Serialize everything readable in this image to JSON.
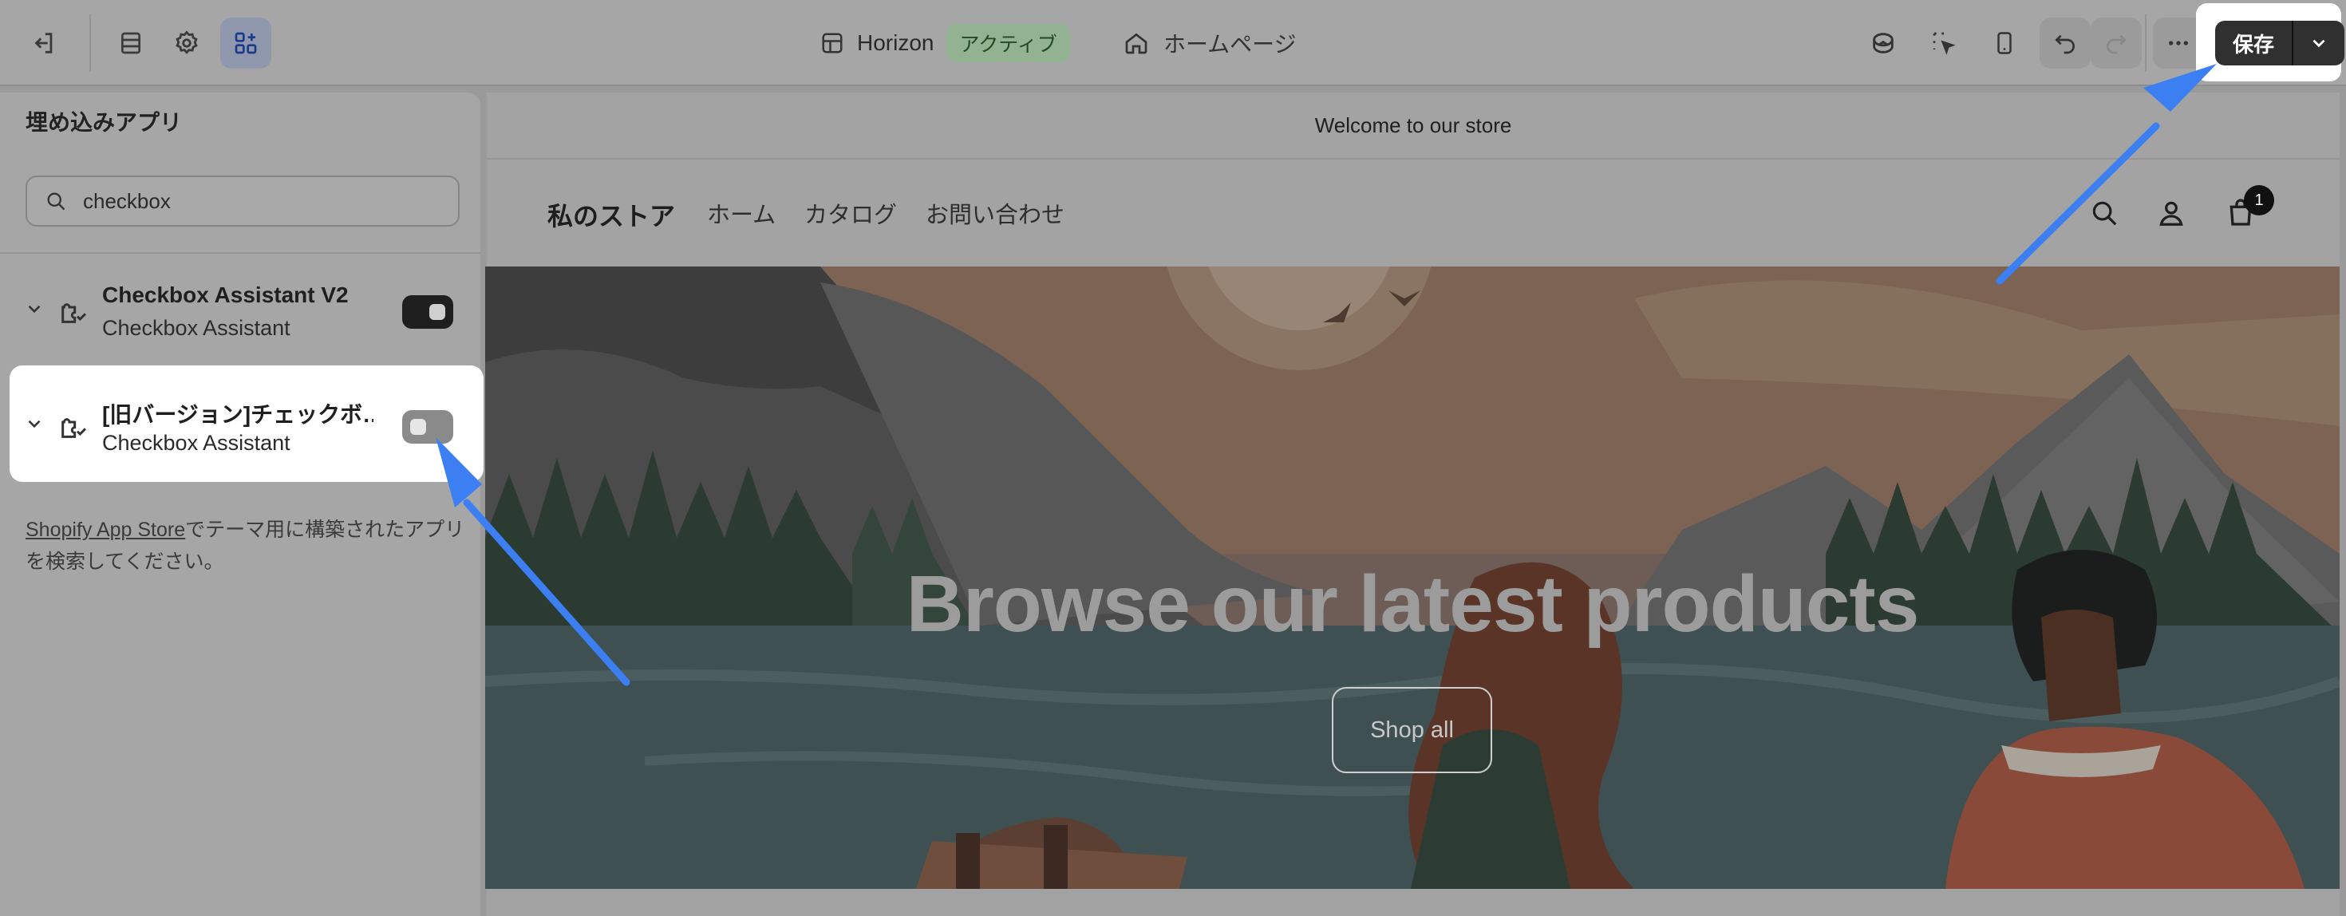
{
  "topbar": {
    "icons": [
      "exit-icon",
      "sections-icon",
      "gear-icon",
      "apps-icon"
    ],
    "theme_name": "Horizon",
    "theme_status": "アクティブ",
    "page_label": "ホームページ",
    "right_icons": [
      "ai-sparkle-icon",
      "inspector-icon",
      "mobile-icon",
      "undo-icon",
      "redo-icon",
      "more-icon"
    ],
    "save_label": "保存"
  },
  "sidebar": {
    "title": "埋め込みアプリ",
    "search_value": "checkbox",
    "apps": [
      {
        "name": "Checkbox Assistant V2",
        "developer": "Checkbox Assistant",
        "enabled": true
      },
      {
        "name": "[旧バージョン]チェックボ…",
        "developer": "Checkbox Assistant",
        "enabled": false
      }
    ],
    "help_link": "Shopify App Store",
    "help_text": "でテーマ用に構築されたアプリを検索してください。"
  },
  "preview": {
    "announcement": "Welcome to our store",
    "store_name": "私のストア",
    "nav": [
      "ホーム",
      "カタログ",
      "お問い合わせ"
    ],
    "cart_count": "1",
    "hero_title": "Browse our latest products",
    "hero_button": "Shop all"
  },
  "colors": {
    "annotation_arrow": "#3b7ff2",
    "active_badge": "#93b291",
    "save_button": "#303030"
  }
}
